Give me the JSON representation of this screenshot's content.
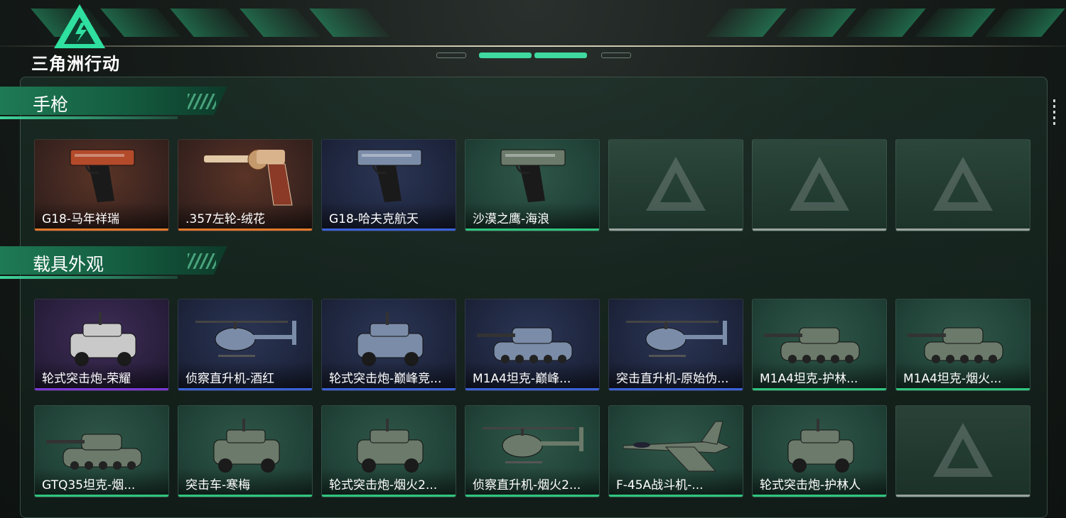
{
  "header": {
    "title": "三角洲行动",
    "logo_icon": "delta-triangle-logo-icon"
  },
  "colors": {
    "accent": "#3fd59c",
    "orange": "#e07a2b",
    "blue": "#3b62d9",
    "green": "#2fc47e",
    "purple": "#7b39d6",
    "empty": "#9aa3a0"
  },
  "sections": [
    {
      "title": "手枪",
      "rows": [
        [
          {
            "name": "G18-马年祥瑞",
            "rarity": "orange",
            "icon": "pistol-icon"
          },
          {
            "name": ".357左轮-绒花",
            "rarity": "orange",
            "icon": "revolver-icon"
          },
          {
            "name": "G18-哈夫克航天",
            "rarity": "blue",
            "icon": "pistol-icon"
          },
          {
            "name": "沙漠之鹰-海浪",
            "rarity": "green",
            "icon": "pistol-icon"
          },
          {
            "name": "",
            "rarity": "empty"
          },
          {
            "name": "",
            "rarity": "empty"
          },
          {
            "name": "",
            "rarity": "empty"
          }
        ]
      ]
    },
    {
      "title": "载具外观",
      "rows": [
        [
          {
            "name": "轮式突击炮-荣耀",
            "rarity": "purple",
            "icon": "armored-car-icon"
          },
          {
            "name": "侦察直升机-酒红",
            "rarity": "blue",
            "icon": "helicopter-icon"
          },
          {
            "name": "轮式突击炮-巅峰竞...",
            "rarity": "blue",
            "icon": "armored-car-icon"
          },
          {
            "name": "M1A4坦克-巅峰...",
            "rarity": "blue",
            "icon": "tank-icon"
          },
          {
            "name": "突击直升机-原始伪...",
            "rarity": "blue",
            "icon": "attack-helicopter-icon"
          },
          {
            "name": "M1A4坦克-护林...",
            "rarity": "green",
            "icon": "tank-icon"
          },
          {
            "name": "M1A4坦克-烟火...",
            "rarity": "green",
            "icon": "tank-icon"
          }
        ],
        [
          {
            "name": "GTQ35坦克-烟...",
            "rarity": "green",
            "icon": "tank-icon"
          },
          {
            "name": "突击车-寒梅",
            "rarity": "green",
            "icon": "assault-vehicle-icon"
          },
          {
            "name": "轮式突击炮-烟火2...",
            "rarity": "green",
            "icon": "armored-car-icon"
          },
          {
            "name": "侦察直升机-烟火2...",
            "rarity": "green",
            "icon": "helicopter-icon"
          },
          {
            "name": "F-45A战斗机-...",
            "rarity": "green",
            "icon": "fighter-jet-icon"
          },
          {
            "name": "轮式突击炮-护林人",
            "rarity": "green",
            "icon": "armored-car-icon"
          },
          {
            "name": "",
            "rarity": "empty"
          }
        ]
      ]
    }
  ]
}
